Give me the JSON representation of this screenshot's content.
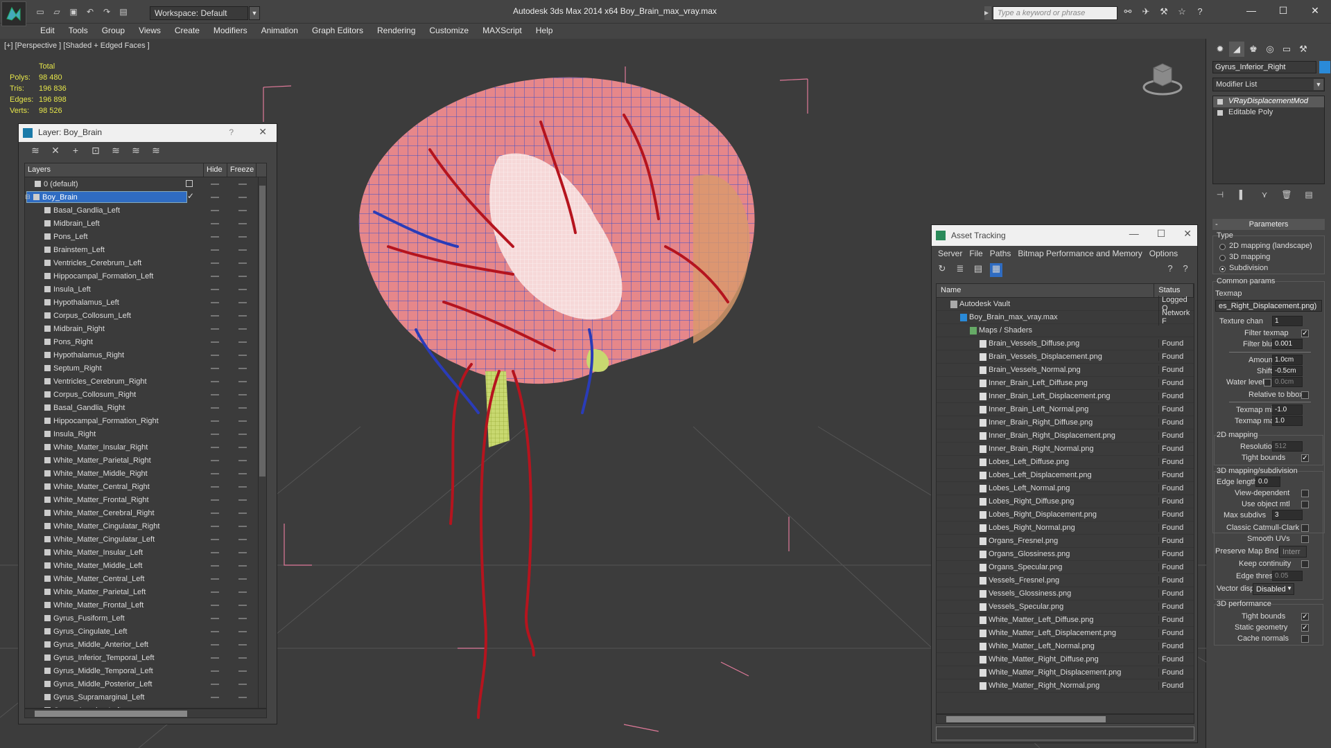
{
  "app": {
    "title": "Autodesk 3ds Max  2014 x64      Boy_Brain_max_vray.max",
    "workspace": "Workspace: Default",
    "search_placeholder": "Type a keyword or phrase"
  },
  "menu": [
    "Edit",
    "Tools",
    "Group",
    "Views",
    "Create",
    "Modifiers",
    "Animation",
    "Graph Editors",
    "Rendering",
    "Customize",
    "MAXScript",
    "Help"
  ],
  "viewport": {
    "label": "[+] [Perspective ] [Shaded + Edged Faces ]",
    "stats": {
      "header": "Total",
      "rows": [
        {
          "k": "Polys:",
          "v": "98 480"
        },
        {
          "k": "Tris:",
          "v": "196 836"
        },
        {
          "k": "Edges:",
          "v": "196 898"
        },
        {
          "k": "Verts:",
          "v": "98 526"
        }
      ]
    }
  },
  "layer_window": {
    "title": "Layer: Boy_Brain",
    "help": "?",
    "columns": {
      "layers": "Layers",
      "hide": "Hide",
      "freeze": "Freeze"
    },
    "default_layer": "0 (default)",
    "selected_layer": "Boy_Brain",
    "objects": [
      "Basal_Gandlia_Left",
      "Midbrain_Left",
      "Pons_Left",
      "Brainstem_Left",
      "Ventricles_Cerebrum_Left",
      "Hippocampal_Formation_Left",
      "Insula_Left",
      "Hypothalamus_Left",
      "Corpus_Collosum_Left",
      "Midbrain_Right",
      "Pons_Right",
      "Hypothalamus_Right",
      "Septum_Right",
      "Ventricles_Cerebrum_Right",
      "Corpus_Collosum_Right",
      "Basal_Gandlia_Right",
      "Hippocampal_Formation_Right",
      "Insula_Right",
      "White_Matter_Insular_Right",
      "White_Matter_Parietal_Right",
      "White_Matter_Middle_Right",
      "White_Matter_Central_Right",
      "White_Matter_Frontal_Right",
      "White_Matter_Cerebral_Right",
      "White_Matter_Cingulatar_Right",
      "White_Matter_Cingulatar_Left",
      "White_Matter_Insular_Left",
      "White_Matter_Middle_Left",
      "White_Matter_Central_Left",
      "White_Matter_Parietal_Left",
      "White_Matter_Frontal_Left",
      "Gyrus_Fusiform_Left",
      "Gyrus_Cingulate_Left",
      "Gyrus_Middle_Anterior_Left",
      "Gyrus_Inferior_Temporal_Left",
      "Gyrus_Middle_Temporal_Left",
      "Gyrus_Middle_Posterior_Left",
      "Gyrus_Supramarginal_Left",
      "Gyrus_Angular_Left"
    ]
  },
  "asset_window": {
    "title": "Asset Tracking",
    "menu": [
      "Server",
      "File",
      "Paths",
      "Bitmap Performance and Memory",
      "Options"
    ],
    "columns": {
      "name": "Name",
      "status": "Status"
    },
    "vault": {
      "name": "Autodesk Vault",
      "status": "Logged O"
    },
    "file": {
      "name": "Boy_Brain_max_vray.max",
      "status": "Network F"
    },
    "maps_group": "Maps / Shaders",
    "maps": [
      {
        "name": "Brain_Vessels_Diffuse.png",
        "status": "Found"
      },
      {
        "name": "Brain_Vessels_Displacement.png",
        "status": "Found"
      },
      {
        "name": "Brain_Vessels_Normal.png",
        "status": "Found"
      },
      {
        "name": "Inner_Brain_Left_Diffuse.png",
        "status": "Found"
      },
      {
        "name": "Inner_Brain_Left_Displacement.png",
        "status": "Found"
      },
      {
        "name": "Inner_Brain_Left_Normal.png",
        "status": "Found"
      },
      {
        "name": "Inner_Brain_Right_Diffuse.png",
        "status": "Found"
      },
      {
        "name": "Inner_Brain_Right_Displacement.png",
        "status": "Found"
      },
      {
        "name": "Inner_Brain_Right_Normal.png",
        "status": "Found"
      },
      {
        "name": "Lobes_Left_Diffuse.png",
        "status": "Found"
      },
      {
        "name": "Lobes_Left_Displacement.png",
        "status": "Found"
      },
      {
        "name": "Lobes_Left_Normal.png",
        "status": "Found"
      },
      {
        "name": "Lobes_Right_Diffuse.png",
        "status": "Found"
      },
      {
        "name": "Lobes_Right_Displacement.png",
        "status": "Found"
      },
      {
        "name": "Lobes_Right_Normal.png",
        "status": "Found"
      },
      {
        "name": "Organs_Fresnel.png",
        "status": "Found"
      },
      {
        "name": "Organs_Glossiness.png",
        "status": "Found"
      },
      {
        "name": "Organs_Specular.png",
        "status": "Found"
      },
      {
        "name": "Vessels_Fresnel.png",
        "status": "Found"
      },
      {
        "name": "Vessels_Glossiness.png",
        "status": "Found"
      },
      {
        "name": "Vessels_Specular.png",
        "status": "Found"
      },
      {
        "name": "White_Matter_Left_Diffuse.png",
        "status": "Found"
      },
      {
        "name": "White_Matter_Left_Displacement.png",
        "status": "Found"
      },
      {
        "name": "White_Matter_Left_Normal.png",
        "status": "Found"
      },
      {
        "name": "White_Matter_Right_Diffuse.png",
        "status": "Found"
      },
      {
        "name": "White_Matter_Right_Displacement.png",
        "status": "Found"
      },
      {
        "name": "White_Matter_Right_Normal.png",
        "status": "Found"
      }
    ]
  },
  "command_panel": {
    "object_name": "Gyrus_Inferior_Right",
    "object_color": "#2a8ad8",
    "modifier_list": "Modifier List",
    "stack": [
      "VRayDisplacementMod",
      "Editable Poly"
    ],
    "parameters": {
      "header": "Parameters",
      "type_label": "Type",
      "type_options": [
        "2D mapping (landscape)",
        "3D mapping",
        "Subdivision"
      ],
      "type_selected": "Subdivision",
      "common_label": "Common params",
      "texmap_label": "Texmap",
      "texmap_value": "es_Right_Displacement.png)",
      "texture_chan_label": "Texture chan",
      "texture_chan": "1",
      "filter_texmap_label": "Filter texmap",
      "filter_blur_label": "Filter blur",
      "filter_blur": "0.001",
      "amount_label": "Amount",
      "amount": "1.0cm",
      "shift_label": "Shift",
      "shift": "-0.5cm",
      "water_level_label": "Water level",
      "water_level": "0.0cm",
      "relative_bbox_label": "Relative to bbox",
      "texmap_min_label": "Texmap min",
      "texmap_min": "-1.0",
      "texmap_max_label": "Texmap max",
      "texmap_max": "1.0",
      "mapping2d_label": "2D mapping",
      "resolution_label": "Resolution",
      "resolution": "512",
      "tight_bounds_label": "Tight bounds",
      "mapping3d_label": "3D mapping/subdivision",
      "edge_length_label": "Edge length",
      "edge_length": "0.0",
      "view_dependent_label": "View-dependent",
      "use_object_mtl_label": "Use object mtl",
      "max_subdivs_label": "Max subdivs",
      "max_subdivs": "3",
      "catmull_label": "Classic Catmull-Clark",
      "smooth_uvs_label": "Smooth UVs",
      "preserve_label": "Preserve Map Bnd",
      "preserve_value": "Interr",
      "keep_continuity_label": "Keep continuity",
      "edge_thresh_label": "Edge thresh",
      "edge_thresh": "0.05",
      "vector_displ_label": "Vector displ",
      "vector_displ": "Disabled",
      "perf_label": "3D performance",
      "perf_tight_label": "Tight bounds",
      "static_geometry_label": "Static geometry",
      "cache_normals_label": "Cache normals"
    }
  }
}
